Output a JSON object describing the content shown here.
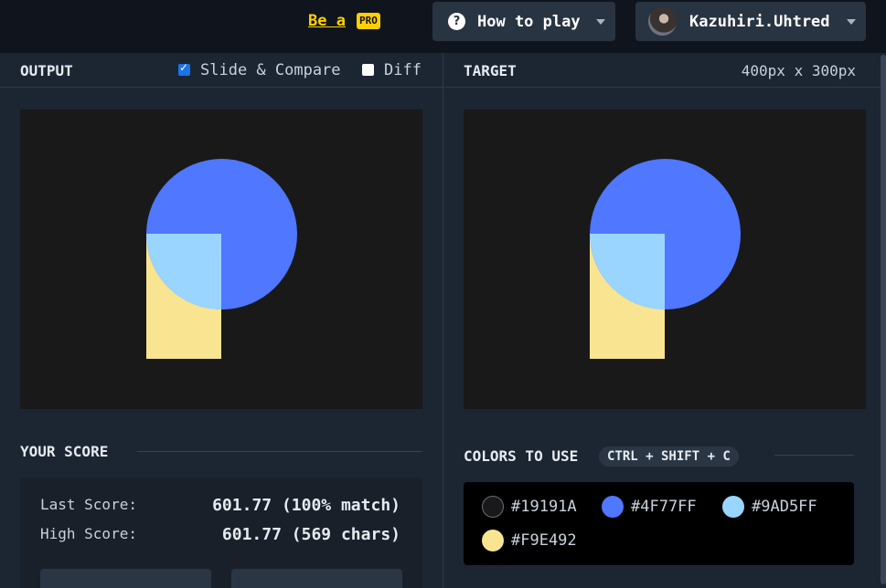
{
  "header": {
    "be_a": "Be a",
    "pro_badge": "PRO",
    "how_to_play": "How to play",
    "username": "Kazuhiri.Uhtred"
  },
  "output": {
    "title": "OUTPUT",
    "slide_compare_label": "Slide & Compare",
    "slide_compare_checked": true,
    "diff_label": "Diff",
    "diff_checked": false
  },
  "target": {
    "title": "TARGET",
    "dimensions": "400px x 300px"
  },
  "score": {
    "title": "YOUR SCORE",
    "last_score_label": "Last Score:",
    "last_score_value": "601.77 (100% match)",
    "high_score_label": "High Score:",
    "high_score_value": "601.77 (569 chars)"
  },
  "colors": {
    "title": "COLORS TO USE",
    "shortcut": "CTRL + SHIFT + C",
    "palette": [
      {
        "hex": "#19191A",
        "color": "#19191A"
      },
      {
        "hex": "#4F77FF",
        "color": "#4F77FF"
      },
      {
        "hex": "#9AD5FF",
        "color": "#9AD5FF"
      },
      {
        "hex": "#F9E492",
        "color": "#F9E492"
      }
    ]
  }
}
